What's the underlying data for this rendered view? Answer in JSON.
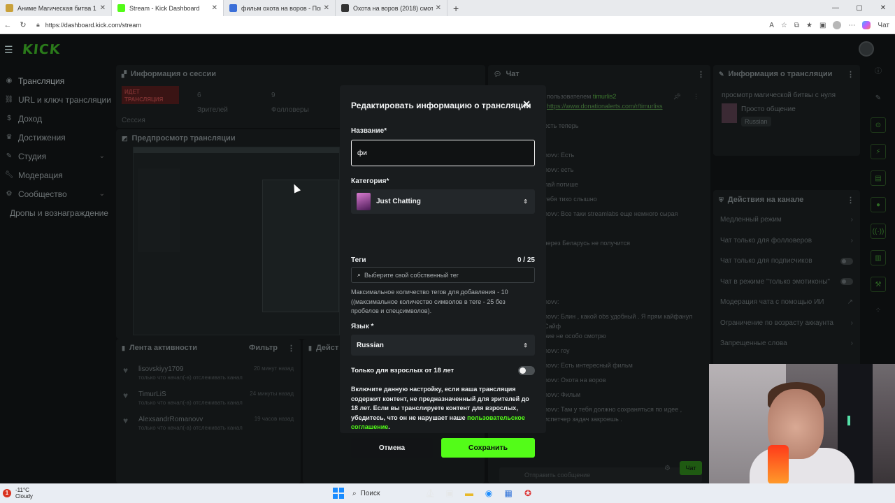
{
  "browser": {
    "tabs": [
      {
        "title": "Аниме Магическая битва 1 сезо",
        "favicon_color": "#c9a13a",
        "active": false
      },
      {
        "title": "Stream - Kick Dashboard",
        "favicon_color": "#53fc18",
        "active": true
      },
      {
        "title": "фильм охота на воров - Поиск",
        "favicon_color": "#3b6fd8",
        "active": false
      },
      {
        "title": "Охота на воров (2018) смотреть",
        "favicon_color": "#333333",
        "active": false
      }
    ],
    "url": "https://dashboard.kick.com/stream",
    "copilot_label": "Чат"
  },
  "app": {
    "logo": "KICK",
    "sidebar": [
      {
        "label": "Трансляция",
        "icon": "broadcast-icon",
        "expandable": false,
        "active": true
      },
      {
        "label": "URL и ключ трансляции",
        "icon": "link-icon",
        "expandable": false
      },
      {
        "label": "Доход",
        "icon": "dollar-icon",
        "expandable": false
      },
      {
        "label": "Достижения",
        "icon": "trophy-icon",
        "expandable": false
      },
      {
        "label": "Студия",
        "icon": "studio-icon",
        "expandable": true
      },
      {
        "label": "Модерация",
        "icon": "wrench-icon",
        "expandable": false
      },
      {
        "label": "Сообщество",
        "icon": "community-icon",
        "expandable": true
      },
      {
        "label": "Дропы и вознаграждение",
        "icon": "",
        "expandable": false
      }
    ],
    "session": {
      "title": "Информация о сессии",
      "live": "ИДЕТ ТРАНСЛЯЦИЯ",
      "session_label": "Сессия",
      "viewers_value": "6",
      "viewers_label": "Зрителей",
      "followers_value": "9",
      "followers_label": "Фолловеры"
    },
    "preview": {
      "title": "Предпросмотр трансляции"
    },
    "activity": {
      "title": "Лента активности",
      "filter": "Фильтр",
      "items": [
        {
          "name": "lisovskiyy1709",
          "sub": "только что начал(-а) отслеживать канал",
          "time": "20 минут назад"
        },
        {
          "name": "TimurLiS",
          "sub": "только что начал(-а) отслеживать канал",
          "time": "24 минуты назад"
        },
        {
          "name": "AlexsandrRomanovv",
          "sub": "только что начал(-а) отслеживать канал",
          "time": "19 часов назад"
        }
      ]
    },
    "actions_short": "Дейст",
    "chat": {
      "title": "Чат",
      "pinned_by": "пользователем",
      "pinned_user": "timurlis2",
      "pinned_link": "https://www.donationalerts.com/r/timurliss",
      "lines": [
        "есть теперь",
        "",
        "novv: Есть",
        "novv: есть",
        "лай потише",
        "тебя тихо слышно",
        "novv: Все таки streamlabs еще немного сырая",
        "",
        "через Беларусь не получится",
        "",
        "",
        "",
        "novv:",
        "novv: Блин , какой obs удобный . Я прям кайфанул",
        "Сайф",
        "ние не особо смотрю",
        "novv: гоу",
        "novv: Есть интересный фильм",
        "novv: Охота на воров",
        "novv: Фильм",
        "novv: Там у тебя должно сохраняться по идее ,",
        "испетчер задач закроешь ."
      ],
      "input_placeholder": "Отправить сообщение",
      "send_label": "Чат"
    },
    "stream_info": {
      "title": "Информация о трансляции",
      "stream_title": "просмотр магической битвы с нуля",
      "category": "Просто общение",
      "language": "Russian"
    },
    "channel_actions": {
      "title": "Действия на канале",
      "items": [
        {
          "label": "Медленный режим",
          "control": "chevron"
        },
        {
          "label": "Чат только для фолловеров",
          "control": "chevron"
        },
        {
          "label": "Чат только для подписчиков",
          "control": "toggle"
        },
        {
          "label": "Чат в режиме \"только эмотиконы\"",
          "control": "toggle"
        },
        {
          "label": "Модерация чата с помощью ИИ",
          "control": "external"
        },
        {
          "label": "Ограничение по возрасту аккаунта",
          "control": "chevron"
        },
        {
          "label": "Запрещенные слова",
          "control": "chevron"
        }
      ]
    }
  },
  "modal": {
    "title": "Редактировать информацию о трансляции",
    "name_label": "Название*",
    "name_value": "фи",
    "category_label": "Категория*",
    "category_value": "Just Chatting",
    "tags_label": "Теги",
    "tags_count": "0 / 25",
    "tags_placeholder": "Выберите свой собственный тег",
    "tags_help": "Максимальное количество тегов для добавления - 10 ((максимальное количество символов в теге - 25 без пробелов и спецсимволов).",
    "language_label": "Язык *",
    "language_value": "Russian",
    "adult_label": "Только для взрослых от 18 лет",
    "adult_on": false,
    "adult_warning": "Включите данную настройку, если ваша трансляция содержит контент, не предназначенный для зрителей до 18 лет. Если вы транслируете контент для взрослых, убедитесь, что он не нарушает наше",
    "agreement_link": "пользовательское соглашение",
    "agreement_end": ".",
    "cancel_label": "Отмена",
    "save_label": "Сохранить",
    "accent": "#53fc18"
  },
  "taskbar": {
    "temperature": "-11°C",
    "weather": "Cloudy",
    "search_label": "Поиск"
  }
}
